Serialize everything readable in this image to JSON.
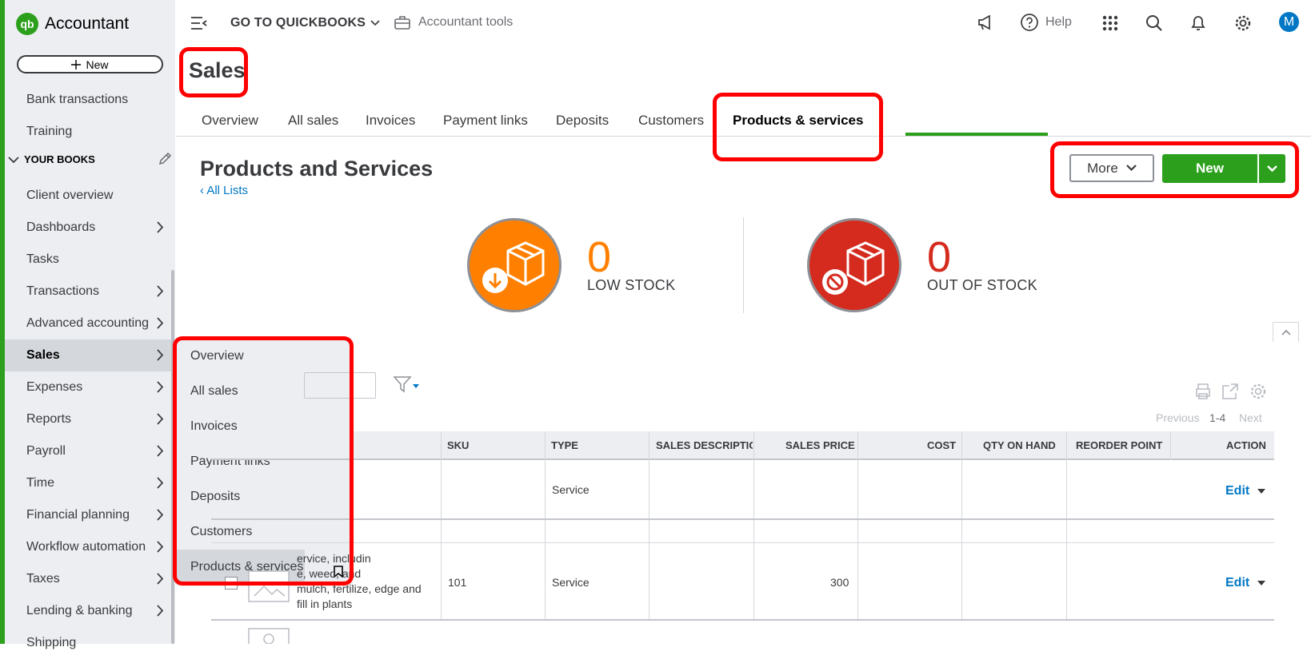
{
  "app": {
    "name": "Accountant",
    "logo": "qb"
  },
  "sidebar": {
    "new_button": "New",
    "items_top": [
      "Bank transactions",
      "Training"
    ],
    "section_label": "YOUR BOOKS",
    "items": [
      {
        "label": "Client overview",
        "chevron": false
      },
      {
        "label": "Dashboards",
        "chevron": true
      },
      {
        "label": "Tasks",
        "chevron": false
      },
      {
        "label": "Transactions",
        "chevron": true
      },
      {
        "label": "Advanced accounting",
        "chevron": true
      },
      {
        "label": "Sales",
        "chevron": true,
        "active": true
      },
      {
        "label": "Expenses",
        "chevron": true
      },
      {
        "label": "Reports",
        "chevron": true
      },
      {
        "label": "Payroll",
        "chevron": true
      },
      {
        "label": "Time",
        "chevron": true
      },
      {
        "label": "Financial planning",
        "chevron": true
      },
      {
        "label": "Workflow automation",
        "chevron": true
      },
      {
        "label": "Taxes",
        "chevron": true
      },
      {
        "label": "Lending & banking",
        "chevron": true
      },
      {
        "label": "Shipping",
        "chevron": false
      }
    ]
  },
  "flyout": {
    "items": [
      "Overview",
      "All sales",
      "Invoices",
      "Payment links",
      "Deposits",
      "Customers",
      "Products & services"
    ],
    "active_index": 6
  },
  "topbar": {
    "goto": "GO TO QUICKBOOKS",
    "accountant_tools": "Accountant tools",
    "help": "Help",
    "avatar_initial": "M"
  },
  "page": {
    "title": "Sales",
    "tabs": [
      "Overview",
      "All sales",
      "Invoices",
      "Payment links",
      "Deposits",
      "Customers",
      "Products & services"
    ],
    "active_tab": "Products & services"
  },
  "products": {
    "title": "Products and Services",
    "all_lists": "All Lists",
    "more_button": "More",
    "new_button": "New",
    "low_stock": {
      "count": "0",
      "label": "LOW STOCK",
      "color": "#ff8000"
    },
    "out_of_stock": {
      "count": "0",
      "label": "OUT OF STOCK",
      "color": "#d52b1e"
    }
  },
  "table": {
    "pager": {
      "previous": "Previous",
      "range": "1-4",
      "next": "Next"
    },
    "columns": [
      "SKU",
      "TYPE",
      "SALES DESCRIPTIO",
      "SALES PRICE",
      "COST",
      "QTY ON HAND",
      "REORDER POINT",
      "ACTION"
    ],
    "rows": [
      {
        "name_desc": "",
        "sku": "",
        "type": "Service",
        "sales_desc": "",
        "price": "",
        "cost": "",
        "qty": "",
        "reorder": "",
        "action": "Edit"
      },
      {
        "name_desc": [
          "ervice, includin",
          "e, weed, and",
          "mulch, fertilize, edge and",
          "fill in plants"
        ],
        "sku": "101",
        "type": "Service",
        "sales_desc": "",
        "price": "300",
        "cost": "",
        "qty": "",
        "reorder": "",
        "action": "Edit"
      }
    ]
  },
  "colors": {
    "brand_green": "#2ca01c",
    "link_blue": "#0077c5",
    "highlight_red": "#ff0000"
  }
}
